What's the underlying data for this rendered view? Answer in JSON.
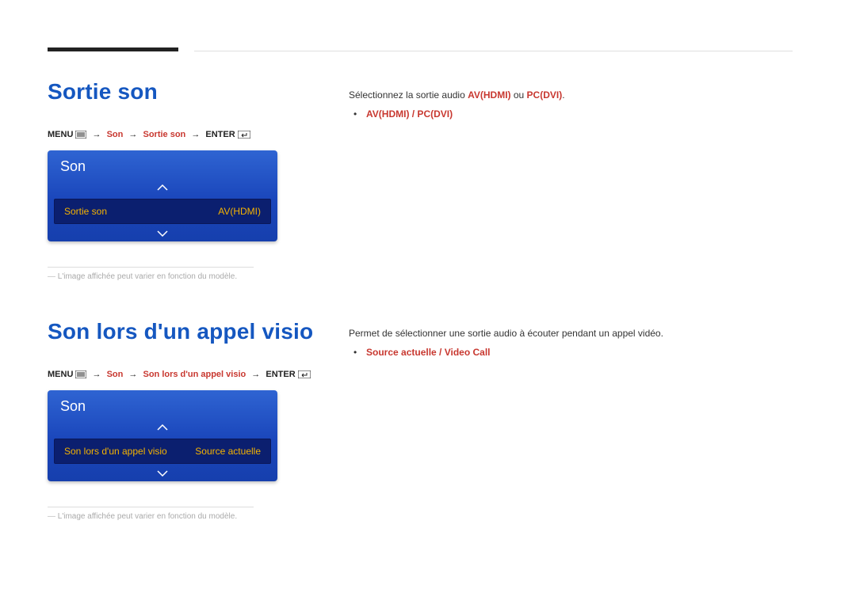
{
  "s1": {
    "title": "Sortie son",
    "bc": {
      "menu": "MENU",
      "arrow": "→",
      "p1": "Son",
      "p2": "Sortie son",
      "enter": "ENTER"
    },
    "panel": {
      "title": "Son",
      "row_label": "Sortie son",
      "row_value": "AV(HDMI)"
    },
    "footnote": "L'image affichée peut varier en fonction du modèle.",
    "desc_pre": "Sélectionnez la sortie audio ",
    "desc_em1": "AV(HDMI)",
    "desc_mid": " ou ",
    "desc_em2": "PC(DVI)",
    "desc_post": ".",
    "bullet": "AV(HDMI) / PC(DVI)"
  },
  "s2": {
    "title": "Son lors d'un appel visio",
    "bc": {
      "menu": "MENU",
      "arrow": "→",
      "p1": "Son",
      "p2": "Son lors d'un appel visio",
      "enter": "ENTER"
    },
    "panel": {
      "title": "Son",
      "row_label": "Son lors d'un appel visio",
      "row_value": "Source actuelle"
    },
    "footnote": "L'image affichée peut varier en fonction du modèle.",
    "desc": "Permet de sélectionner une sortie audio à écouter pendant un appel vidéo.",
    "bullet": "Source actuelle / Video Call"
  }
}
